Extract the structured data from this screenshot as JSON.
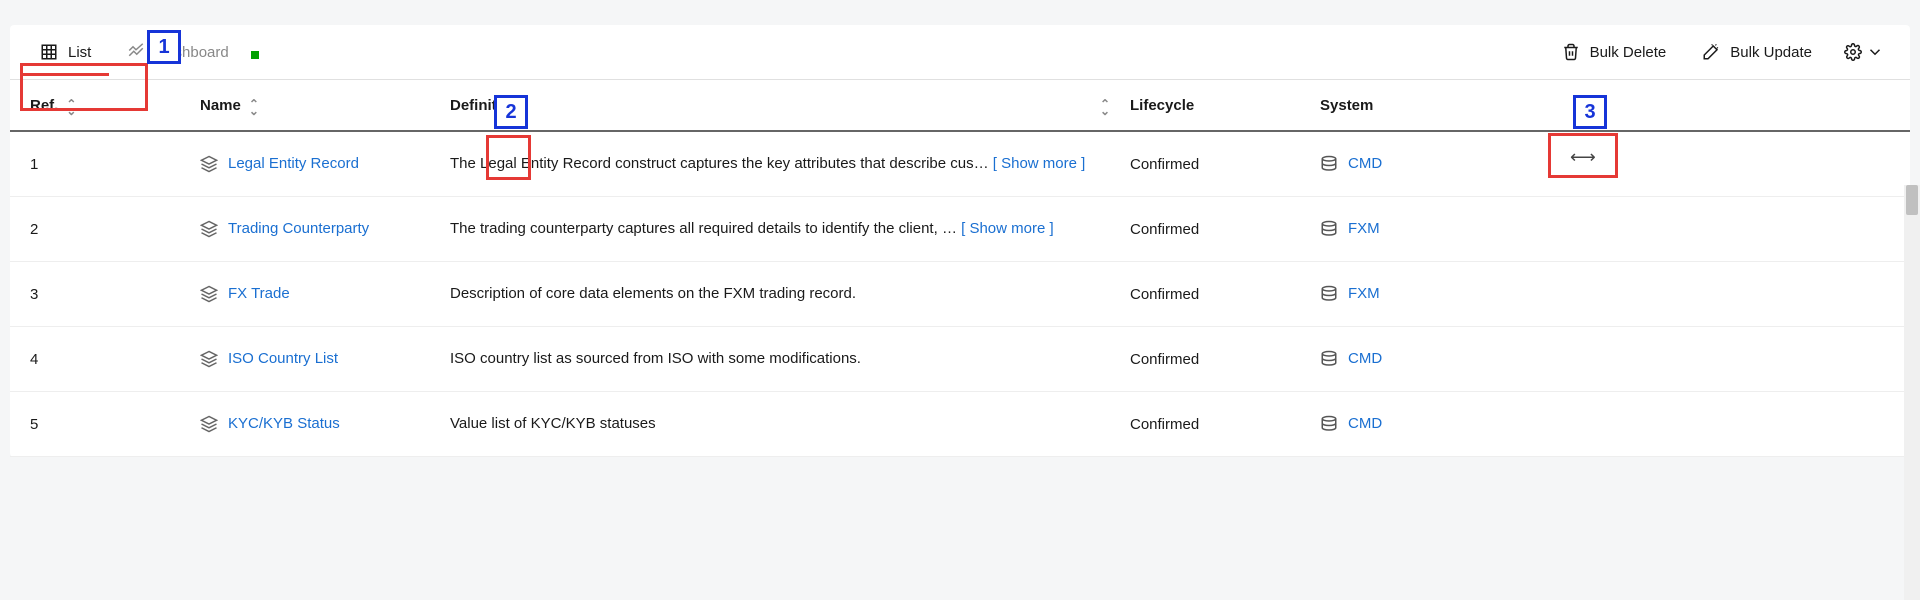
{
  "tabs": {
    "list": "List",
    "dashboard": "Dashboard"
  },
  "actions": {
    "bulkdelete": "Bulk Delete",
    "bulkupdate": "Bulk Update"
  },
  "cols": {
    "ref": "Ref.",
    "name": "Name",
    "def": "Definition",
    "life": "Lifecycle",
    "sys": "System"
  },
  "showmore_open": "[ Show more ]",
  "rows": [
    {
      "ref": "1",
      "name": "Legal Entity Record",
      "def": "The Legal Entity Record construct captures the key attributes that describe cus…  ",
      "showmore": true,
      "life": "Confirmed",
      "sys": "CMD"
    },
    {
      "ref": "2",
      "name": "Trading Counterparty",
      "def": "The trading counterparty captures all required details to identify the client, …  ",
      "showmore": true,
      "life": "Confirmed",
      "sys": "FXM"
    },
    {
      "ref": "3",
      "name": "FX Trade",
      "def": "Description of core data elements on the FXM trading record.",
      "showmore": false,
      "life": "Confirmed",
      "sys": "FXM"
    },
    {
      "ref": "4",
      "name": "ISO Country List",
      "def": "ISO country list as sourced from ISO with some modifications.",
      "showmore": false,
      "life": "Confirmed",
      "sys": "CMD"
    },
    {
      "ref": "5",
      "name": "KYC/KYB Status",
      "def": "Value list of KYC/KYB statuses",
      "showmore": false,
      "life": "Confirmed",
      "sys": "CMD"
    }
  ],
  "callouts": {
    "1": "1",
    "2": "2",
    "3": "3"
  }
}
